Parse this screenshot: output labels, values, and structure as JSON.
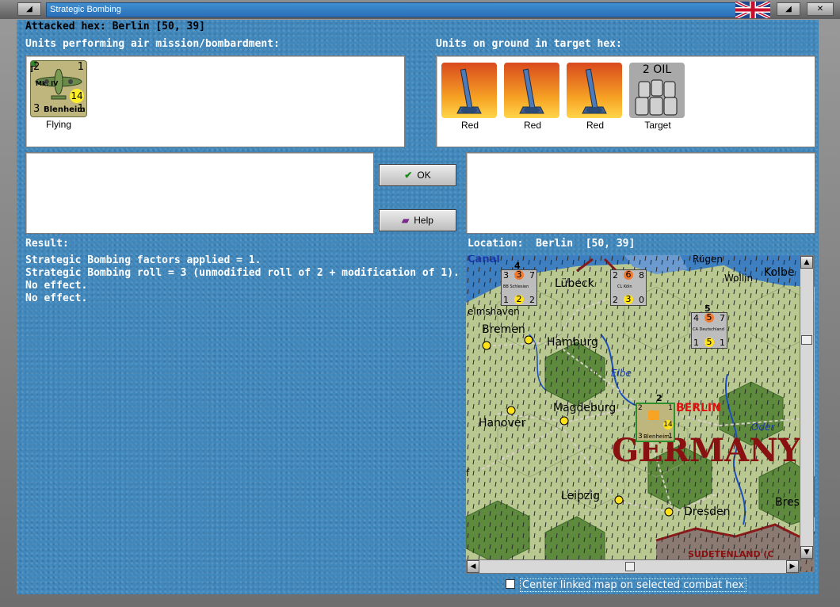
{
  "window": {
    "title": "Strategic Bombing",
    "min_button": "◢",
    "close_button": "✕",
    "restore_button": "◢"
  },
  "header": {
    "attacked_hex": "Attacked hex: Berlin  [50, 39]"
  },
  "air_units": {
    "label": "Units performing air mission/bombardment:",
    "units": [
      {
        "top_left": "2",
        "top_right": "1",
        "bottom_left": "3",
        "bottom_right": "1",
        "badge": "14",
        "type": "Mk. IV",
        "name": "Blenheim",
        "caption": "Flying"
      }
    ]
  },
  "ground_units": {
    "label": "Units on ground in target hex:",
    "units": [
      {
        "kind": "aa-gun",
        "caption": "Red"
      },
      {
        "kind": "aa-gun",
        "caption": "Red"
      },
      {
        "kind": "aa-gun",
        "caption": "Red"
      },
      {
        "kind": "oil",
        "value": "2 OIL",
        "caption": "Target"
      }
    ]
  },
  "buttons": {
    "ok": "OK",
    "help": "Help"
  },
  "result": {
    "label": "Result:",
    "lines": [
      "Strategic Bombing factors applied = 1.",
      "Strategic Bombing roll = 3 (unmodified roll of 2 + modification of 1).",
      "No effect.",
      "No effect."
    ]
  },
  "location": {
    "label": "Location:  Berlin  [50, 39]"
  },
  "map": {
    "place_labels": {
      "canal": "Canal",
      "rugen": "Rügen",
      "lubeck": "Lübeck",
      "wollin": "Wollin",
      "kolbe": "Kolbe",
      "wilhelmshaven": "elmshaven",
      "bremen": "Bremen",
      "hamburg": "Hamburg",
      "elbe": "Elbe",
      "magdeburg": "Magdeburg",
      "berlin": "BERLIN",
      "hanover": "Hanover",
      "oder": "Oder",
      "germany": "GERMANY",
      "leipzig": "Leipzig",
      "bres": "Bres",
      "dresden": "Dresden",
      "sudetenland": "SUDETENLAND (C",
      "edge_f": "f"
    },
    "naval_units": [
      {
        "stack": "4",
        "tl": "3",
        "tc": "3",
        "tr": "7",
        "bl": "1",
        "bc": "2",
        "br": "2",
        "name": "BB Schlesien"
      },
      {
        "stack": "",
        "tl": "2",
        "tc": "6",
        "tr": "8",
        "bl": "2",
        "bc": "3",
        "br": "0",
        "name": "CL Köln"
      },
      {
        "stack": "5",
        "tl": "4",
        "tc": "5",
        "tr": "7",
        "bl": "1",
        "bc": "5",
        "br": "1",
        "name": "CA Deutschland"
      }
    ],
    "bomber_on_map": {
      "stack": "2",
      "tl": "2",
      "tr": "1",
      "bl": "3",
      "br": "1",
      "badge": "14",
      "name": "Blenheim"
    },
    "colors": {
      "sea": "#3d7fc0",
      "land": "#b8c890",
      "forest": "#5e8a3e",
      "germany_text": "#8a1111"
    }
  },
  "footer": {
    "center_checkbox_label": "Center linked map on selected combat hex",
    "center_checked": false
  }
}
